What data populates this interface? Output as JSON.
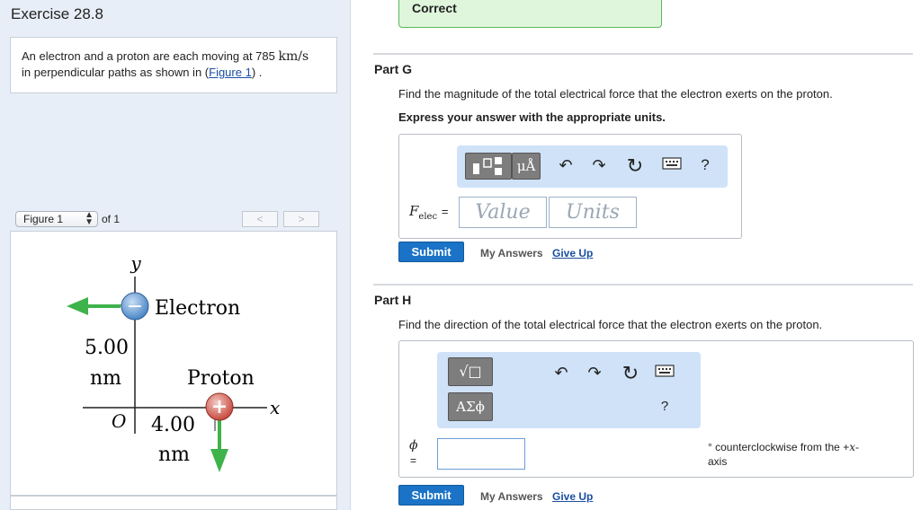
{
  "exercise": {
    "title": "Exercise 28.8"
  },
  "problem": {
    "text_before": "An electron and a proton are each moving at 785 ",
    "speed_unit": "km/s",
    "text_line2": "in perpendicular paths as shown in (",
    "figure_link": "Figure 1",
    "text_after": ") ."
  },
  "figure_nav": {
    "select_value": "Figure 1",
    "of_text": "of 1",
    "prev": "<",
    "next": ">"
  },
  "figure": {
    "y_label": "y",
    "x_label": "x",
    "origin_label": "O",
    "electron_label": "Electron",
    "proton_label": "Proton",
    "electron_sign": "−",
    "proton_sign": "+",
    "dist_y_value": "5.00",
    "dist_y_unit": "nm",
    "dist_x_value": "4.00",
    "dist_x_unit": "nm"
  },
  "status": {
    "correct": "Correct"
  },
  "part_g": {
    "label": "Part G",
    "prompt": "Find the magnitude of the total electrical force that the electron exerts on the proton.",
    "instruct": "Express your answer with the appropriate units.",
    "var_label": "F",
    "var_sub": "elec",
    "equals": "=",
    "value_placeholder": "Value",
    "units_placeholder": "Units",
    "tool_units": "μÅ",
    "help": "?",
    "submit": "Submit",
    "my_answers": "My Answers",
    "give_up": "Give Up"
  },
  "part_h": {
    "label": "Part H",
    "prompt": "Find the direction of the total electrical force that the electron exerts on the proton.",
    "var_label": "ϕ",
    "equals": "=",
    "tool_greek": "ΑΣϕ",
    "tool_root": "√□",
    "help": "?",
    "unit_text": "° counterclockwise from the +",
    "unit_var": "x",
    "unit_text2": "-",
    "unit_line2": "axis",
    "submit": "Submit",
    "my_answers": "My Answers",
    "give_up": "Give Up"
  }
}
